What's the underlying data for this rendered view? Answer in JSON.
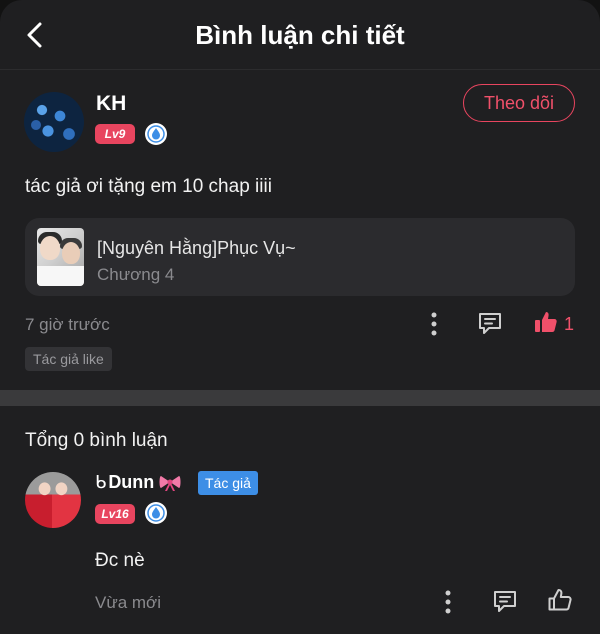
{
  "header": {
    "title": "Bình luận chi tiết",
    "back_icon": "chevron-left-icon"
  },
  "post": {
    "author": "KH",
    "level": "Lv9",
    "follow_label": "Theo dõi",
    "text": "tác giả ơi tặng em 10 chap iiii",
    "story": {
      "title": "[Nguyên Hằng]Phục Vụ~",
      "chapter": "Chương 4"
    },
    "time": "7 giờ trước",
    "like_count": "1",
    "author_like_tag": "Tác giả like"
  },
  "comments_section": {
    "total_label": "Tổng 0 bình luận",
    "comments": [
      {
        "name_prefix": "ᑲ",
        "name": "Dunn",
        "author_tag": "Tác giả",
        "level": "Lv16",
        "text": "Đc nè",
        "time": "Vừa mới"
      }
    ]
  },
  "colors": {
    "background": "#1f1f21",
    "accent_pink": "#e8455f",
    "author_tag_blue": "#3d8ee6",
    "muted_text": "#8a8a8e"
  }
}
